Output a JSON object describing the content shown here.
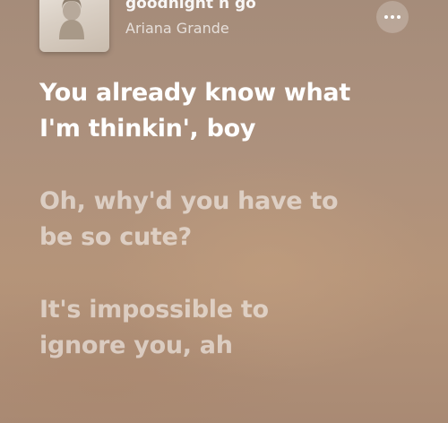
{
  "now_playing": {
    "title": "goodnight n go",
    "artist": "Ariana Grande",
    "more_icon": "ellipsis-icon",
    "artwork_icon": "album-artwork"
  },
  "lyrics": [
    {
      "line1": "You already know what",
      "line2": "I'm thinkin', boy",
      "active": true
    },
    {
      "line1": "Oh, why'd you have to",
      "line2": "be so cute?",
      "active": false
    },
    {
      "line1": "It's impossible to",
      "line2": "ignore you, ah",
      "active": false
    }
  ],
  "colors": {
    "active_lyric": "#ffffff",
    "background": "#ad917d"
  }
}
